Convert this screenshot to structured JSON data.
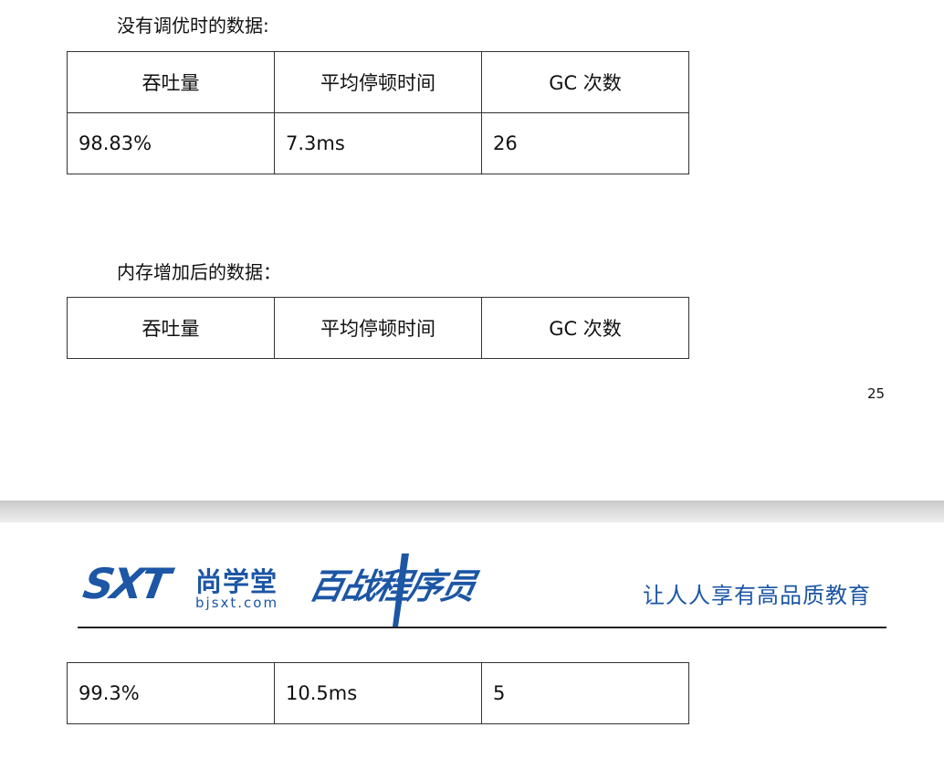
{
  "section1": {
    "title": "没有调优时的数据:",
    "headers": [
      "吞吐量",
      "平均停顿时间",
      "GC 次数"
    ],
    "row": [
      "98.83%",
      "7.3ms",
      "26"
    ]
  },
  "section2": {
    "title": "内存增加后的数据：",
    "headers": [
      "吞吐量",
      "平均停顿时间",
      "GC 次数"
    ],
    "row": [
      "99.3%",
      "10.5ms",
      "5"
    ]
  },
  "page_number": "25",
  "header": {
    "logo_sxt": "SXT",
    "brand": "尚学堂",
    "url": "bjsxt.com",
    "product": "百战程序员",
    "tagline": "让人人享有高品质教育",
    "brand_color": "#1c56a5"
  }
}
